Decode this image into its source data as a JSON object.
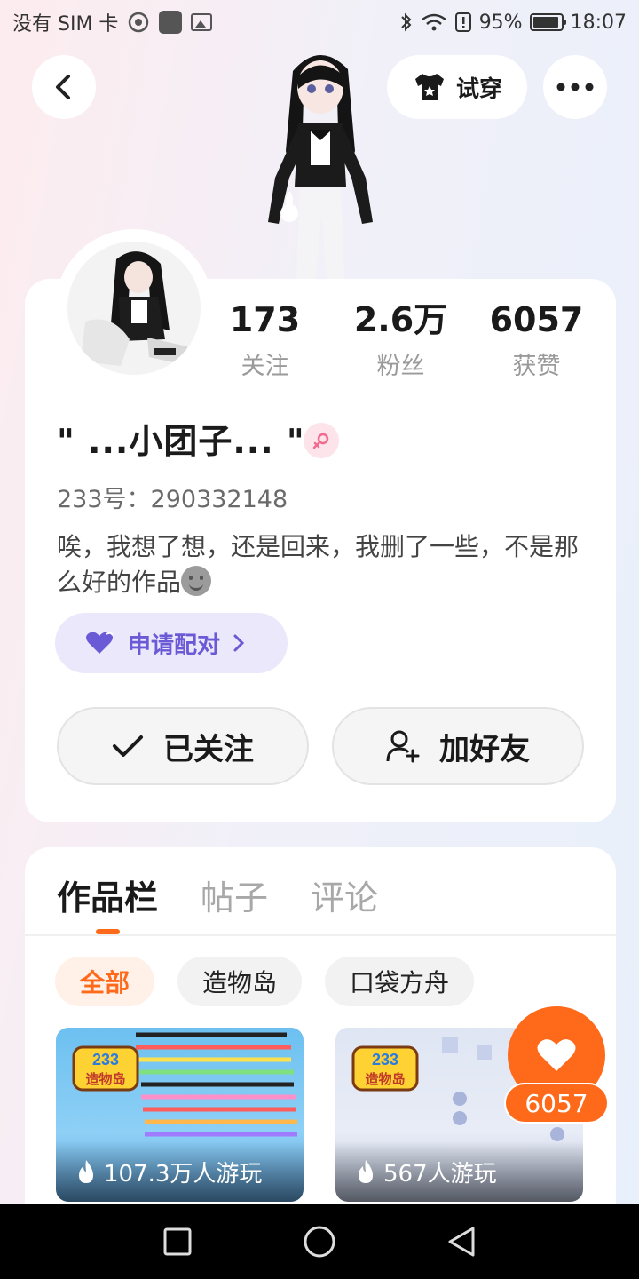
{
  "status_bar": {
    "carrier": "没有 SIM 卡",
    "battery": "95%",
    "battery_level": 0.95,
    "time": "18:07"
  },
  "header": {
    "back_icon": "back-arrow-icon",
    "tryon_label": "试穿",
    "tryon_icon": "shirt-icon",
    "more_icon": "more-dots-icon"
  },
  "profile": {
    "stats": [
      {
        "value": "173",
        "label": "关注"
      },
      {
        "value": "2.6万",
        "label": "粉丝"
      },
      {
        "value": "6057",
        "label": "获赞"
      }
    ],
    "nickname": "\" ...小团子... \"",
    "gender_icon": "female-icon",
    "uid": "233号：290332148",
    "bio": "唉，我想了想，还是回来，我删了一些，不是那么好的作品",
    "match_label": "申请配对",
    "follow_label": "已关注",
    "add_friend_label": "加好友"
  },
  "works": {
    "tabs": [
      {
        "label": "作品栏",
        "active": true
      },
      {
        "label": "帖子",
        "active": false
      },
      {
        "label": "评论",
        "active": false
      }
    ],
    "filters": [
      {
        "label": "全部",
        "active": true
      },
      {
        "label": "造物岛",
        "active": false
      },
      {
        "label": "口袋方舟",
        "active": false
      }
    ],
    "games": [
      {
        "logo_text": "233",
        "logo_sub": "造物岛",
        "plays": "107.3万人游玩"
      },
      {
        "logo_text": "233",
        "logo_sub": "造物岛",
        "plays": "567人游玩"
      }
    ]
  },
  "like_fab": {
    "count": "6057",
    "color": "#ff6a1a"
  },
  "colors": {
    "accent": "#ff6a1a",
    "match_purple": "#6a5ad6",
    "gender_pink": "#f26a8d"
  }
}
